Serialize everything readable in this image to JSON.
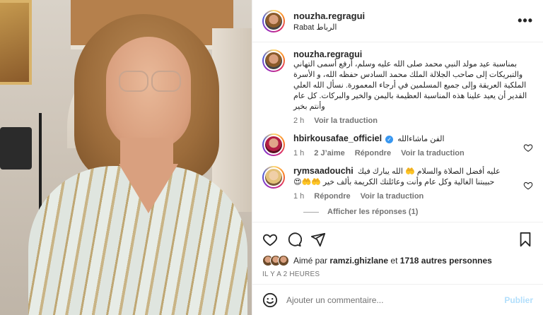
{
  "post": {
    "username": "nouzha.regragui",
    "location": "Rabat الرباط",
    "more_label": "•••"
  },
  "caption": {
    "username": "nouzha.regragui",
    "text": "بمناسبة عيد مولد النبي محمد صلى الله عليه وسلم، أرفع أسمى التهاني والتبريكات إلى صاحب الجلالة الملك محمد السادس حفظه الله، و الأسرة الملكية العريقة وإلى جميع المسلمين في أرجاء المعمورة. نسأل الله العلي القدير أن يعيد علينا هذه المناسبة العظيمة باليمن والخير والبركات. كل عام وأنتم بخير",
    "time": "2 h",
    "translate": "Voir la traduction"
  },
  "comments": [
    {
      "username": "hbirkousafae_officiel",
      "verified": true,
      "text": "الفن ماشاءالله",
      "time": "1 h",
      "likes": "2 J’aime",
      "reply": "Répondre",
      "translate": "Voir la traduction"
    },
    {
      "username": "rymsaadouchi",
      "verified": false,
      "text": "عليه أفضل الصلاة والسلام 🤲 الله يبارك فيك حبيبتنا الغالية وكل عام وأنت وعائلتك الكريمة بألف خير 🤲🤲😍",
      "time": "1 h",
      "reply": "Répondre",
      "translate": "Voir la traduction"
    }
  ],
  "replies_label": "Afficher les réponses (1)",
  "likes": {
    "prefix": "Aimé par",
    "user": "ramzi.ghizlane",
    "and": "et",
    "others": "1718 autres personnes"
  },
  "timestamp": "IL Y A 2 HEURES",
  "add_comment": {
    "placeholder": "Ajouter un commentaire...",
    "publish": "Publier"
  },
  "icons": {
    "like": "heart-icon",
    "comment": "comment-icon",
    "share": "share-icon",
    "save": "bookmark-icon",
    "emoji": "emoji-icon"
  },
  "colors": {
    "accent": "#3897f0",
    "publish_disabled": "#b2dffc"
  }
}
